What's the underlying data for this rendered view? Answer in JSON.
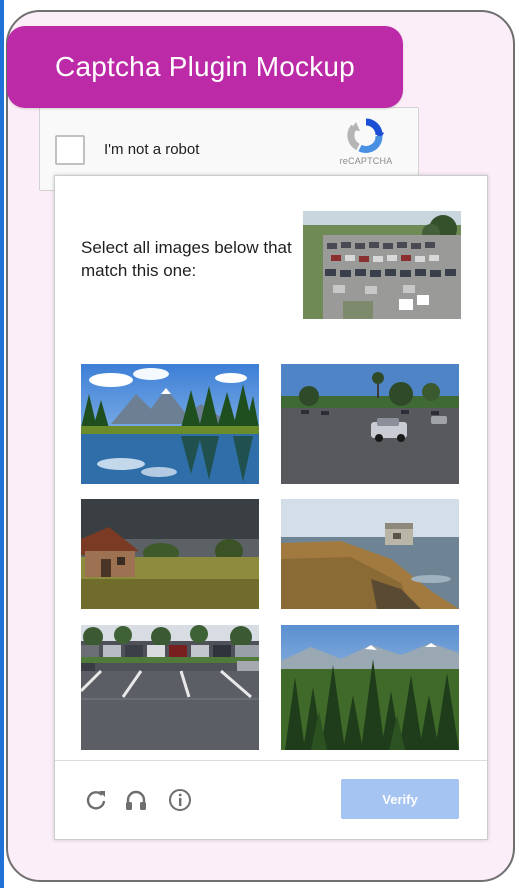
{
  "title": "Captcha Plugin Mockup",
  "recaptcha": {
    "checkbox_label": "I'm not a robot",
    "brand_text": "reCAPTCHA",
    "logo_icon": "recaptcha-logo-icon"
  },
  "challenge": {
    "instruction": "Select all images below that match this one:",
    "reference_image": "parking lot",
    "tiles": [
      {
        "depicts": "mountain lake with trees"
      },
      {
        "depicts": "parking lot with car"
      },
      {
        "depicts": "barn in field"
      },
      {
        "depicts": "rocky coastline"
      },
      {
        "depicts": "parking lot"
      },
      {
        "depicts": "pine forest with mountains"
      }
    ],
    "footer": {
      "reload_icon": "reload-icon",
      "audio_icon": "headphones-icon",
      "info_icon": "info-icon",
      "verify_label": "Verify"
    }
  },
  "colors": {
    "title_background": "#bd2aa8",
    "card_background": "#fbeef8",
    "verify_button": "#a6c4f2",
    "left_accent": "#1f73d8"
  }
}
